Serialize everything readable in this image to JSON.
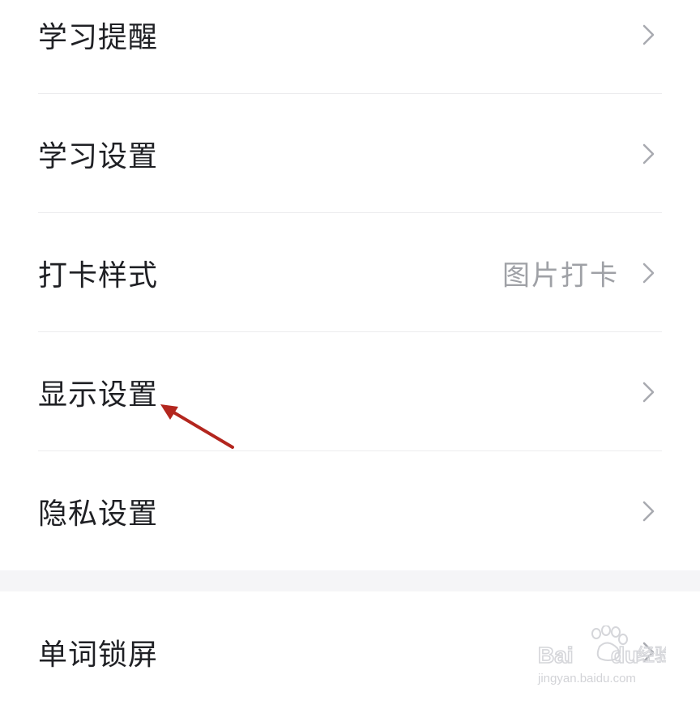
{
  "settings": {
    "items": [
      {
        "label": "学习提醒",
        "value": ""
      },
      {
        "label": "学习设置",
        "value": ""
      },
      {
        "label": "打卡样式",
        "value": "图片打卡"
      },
      {
        "label": "显示设置",
        "value": ""
      },
      {
        "label": "隐私设置",
        "value": ""
      }
    ]
  },
  "second_group": {
    "items": [
      {
        "label": "单词锁屏"
      }
    ]
  },
  "annotation": {
    "arrow_color": "#b3261e"
  },
  "watermark": {
    "logo_text": "Baidu经验",
    "url_text": "jingyan.baidu.com"
  },
  "icons": {
    "chevron": "chevron-right-icon"
  }
}
